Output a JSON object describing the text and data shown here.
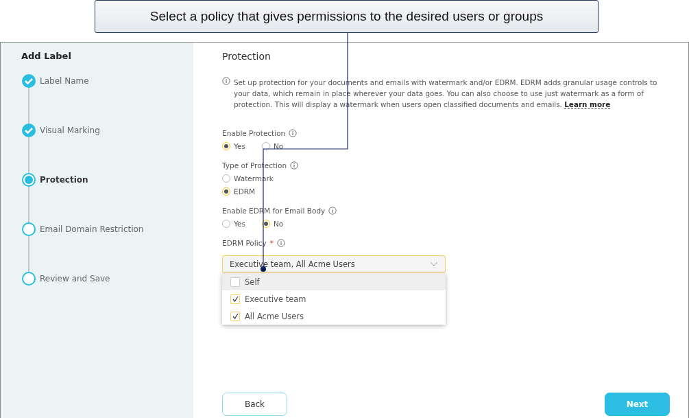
{
  "callout": {
    "text": "Select a policy that gives permissions to the desired users or groups"
  },
  "sidebar": {
    "title": "Add Label",
    "steps": [
      {
        "label": "Label Name",
        "kind": "done"
      },
      {
        "label": "Visual Marking",
        "kind": "done"
      },
      {
        "label": "Protection",
        "kind": "current"
      },
      {
        "label": "Email Domain Restriction",
        "kind": "pending"
      },
      {
        "label": "Review and Save",
        "kind": "pending"
      }
    ]
  },
  "main": {
    "title": "Protection",
    "info": "Set up protection for your documents and emails with watermark and/or EDRM. EDRM adds granular usage controls to your data, which remain in place wherever your data goes. You can also choose to use just watermark as a form of protection. This will display a watermark when users open classified documents and emails.",
    "info_link": "Learn more",
    "fields": [
      {
        "kind": "toggle",
        "label": "Enable Protection",
        "options": [
          {
            "label": "Yes",
            "selected": true
          },
          {
            "label": "No",
            "selected": false
          }
        ]
      },
      {
        "kind": "radio",
        "label": "Type of Protection",
        "options": [
          {
            "label": "Watermark",
            "selected": false
          },
          {
            "label": "EDRM",
            "selected": true
          }
        ]
      },
      {
        "kind": "toggle",
        "label": "Enable EDRM for Email Body",
        "options": [
          {
            "label": "Yes",
            "selected": false
          },
          {
            "label": "No",
            "selected": true
          }
        ]
      },
      {
        "kind": "select",
        "label": "EDRM Policy",
        "required_mark": "*",
        "value": "Executive team, All Acme Users",
        "expanded": true,
        "options": [
          {
            "label": "Self",
            "checked": false,
            "highlighted": true
          },
          {
            "label": "Executive team",
            "checked": true,
            "highlighted": false
          },
          {
            "label": "All Acme Users",
            "checked": true,
            "highlighted": false
          }
        ]
      }
    ]
  },
  "buttons": {
    "back": "Back",
    "next": "Next"
  }
}
